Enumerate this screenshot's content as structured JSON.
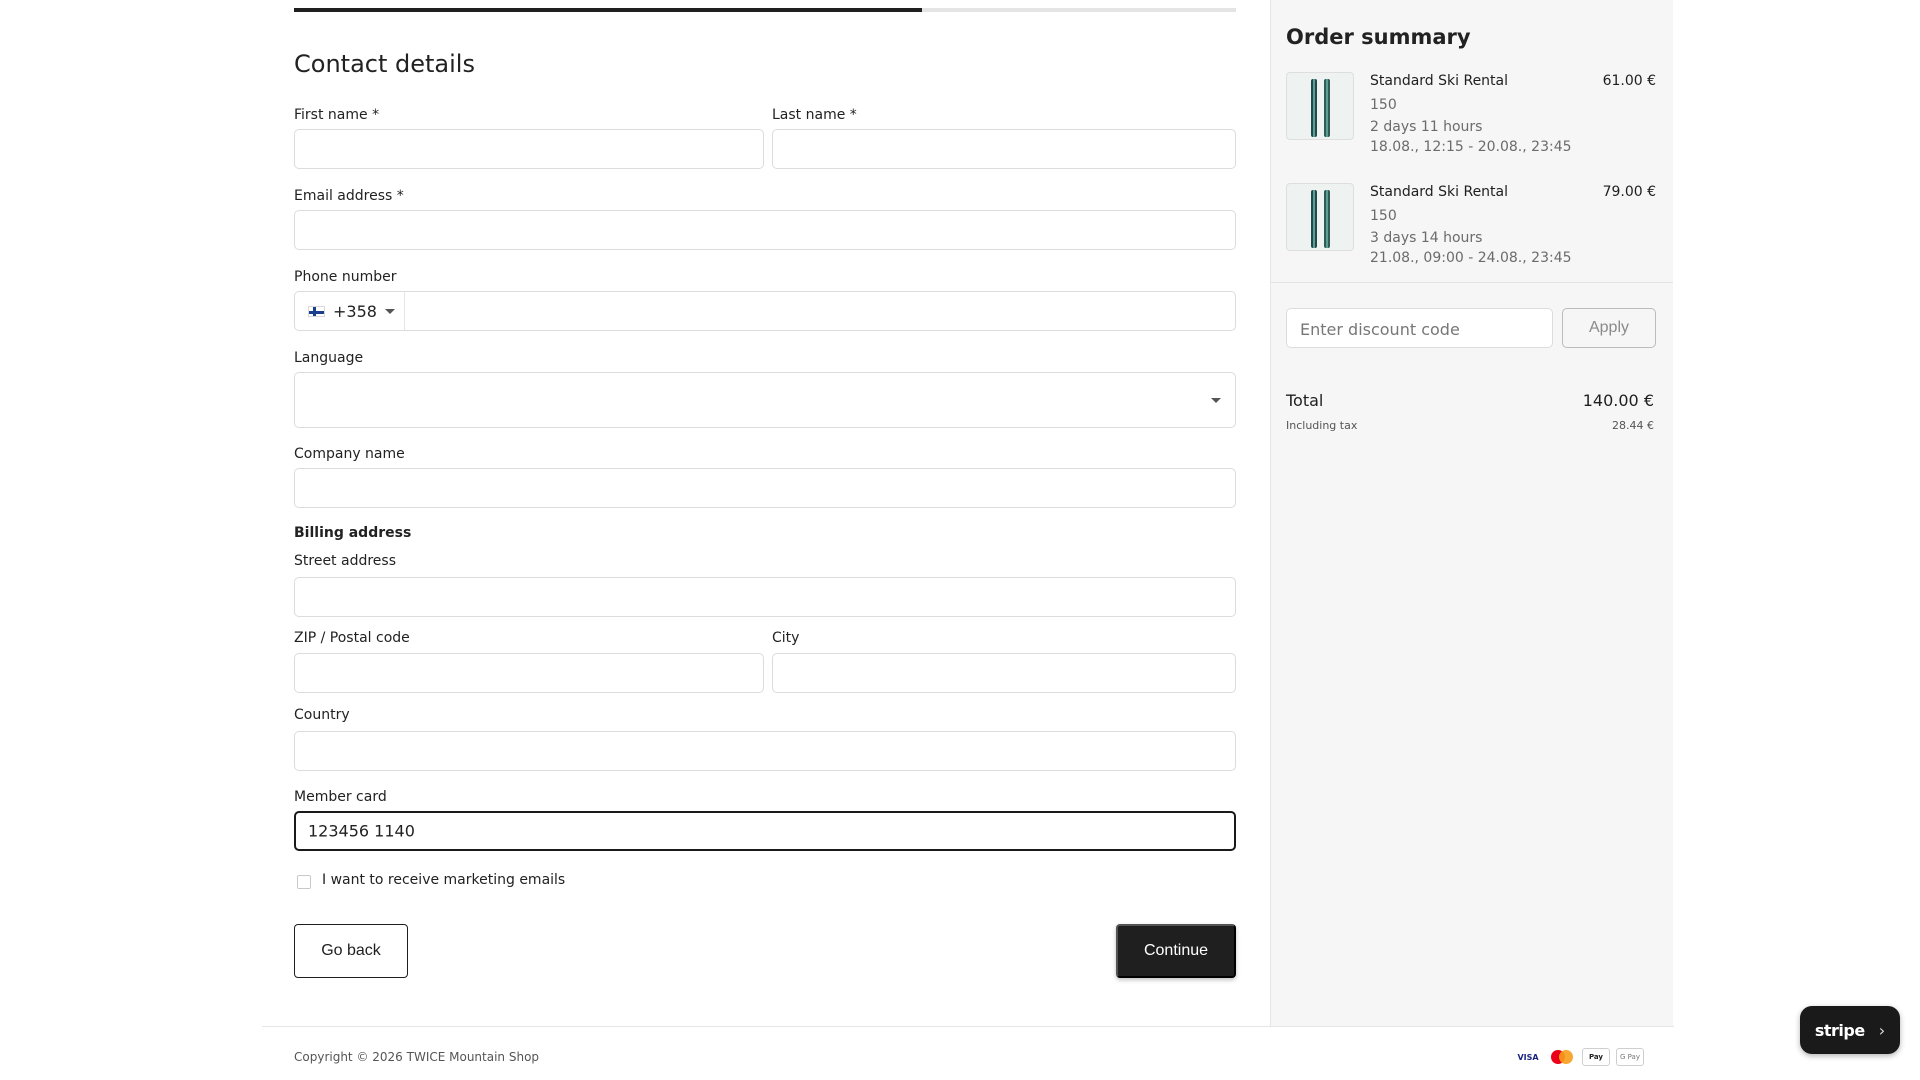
{
  "progress": {
    "completed_fraction": 0.667
  },
  "form": {
    "title": "Contact details",
    "first_name": {
      "label": "First name *",
      "value": ""
    },
    "last_name": {
      "label": "Last name *",
      "value": ""
    },
    "email": {
      "label": "Email address *",
      "value": ""
    },
    "phone": {
      "label": "Phone number",
      "country_flag": "finland-flag-icon",
      "dial_code": "+358",
      "value": ""
    },
    "language": {
      "label": "Language",
      "value": ""
    },
    "company": {
      "label": "Company name",
      "value": ""
    },
    "billing_title": "Billing address",
    "street": {
      "label": "Street address",
      "value": ""
    },
    "zip": {
      "label": "ZIP / Postal code",
      "value": ""
    },
    "city": {
      "label": "City",
      "value": ""
    },
    "country": {
      "label": "Country",
      "value": ""
    },
    "member_card": {
      "label": "Member card",
      "value": "123456 1140"
    },
    "marketing": {
      "label": "I want to receive marketing emails",
      "checked": false
    },
    "back_label": "Go back",
    "continue_label": "Continue"
  },
  "summary": {
    "title": "Order summary",
    "items": [
      {
        "name": "Standard Ski Rental",
        "price": "61.00 €",
        "size": "150",
        "duration": "2 days 11 hours",
        "period": "18.08., 12:15 - 20.08., 23:45"
      },
      {
        "name": "Standard Ski Rental",
        "price": "79.00 €",
        "size": "150",
        "duration": "3 days 14 hours",
        "period": "21.08., 09:00 - 24.08., 23:45"
      }
    ],
    "discount_placeholder": "Enter discount code",
    "apply_label": "Apply",
    "total_label": "Total",
    "total_value": "140.00 €",
    "tax_label": "Including tax",
    "tax_value": "28.44 €"
  },
  "footer": {
    "copyright": "Copyright © 2026 TWICE Mountain Shop",
    "payment_icons": [
      "visa-icon",
      "mastercard-icon",
      "apple-pay-icon",
      "google-pay-icon"
    ],
    "visa_text": "VISA",
    "apple_pay_text": "Pay",
    "google_pay_text": "G Pay"
  },
  "stripe": {
    "label": "stripe",
    "chevron": "›"
  },
  "colors": {
    "primary": "#1f1f1f",
    "sidebar_bg": "#f6f6f6",
    "border": "#dcdcdc"
  }
}
